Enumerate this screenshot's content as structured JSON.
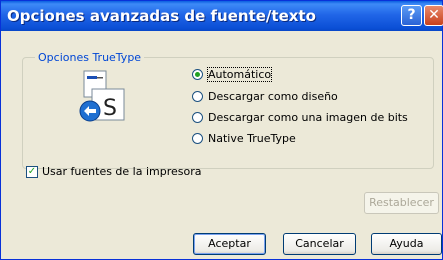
{
  "window": {
    "title": "Opciones avanzadas de fuente/texto",
    "help_glyph": "?",
    "close_glyph": "✕"
  },
  "truetype_group": {
    "legend": "Opciones TrueType",
    "icon": "font-substitution-icon",
    "options": [
      {
        "label": "Automático",
        "selected": true
      },
      {
        "label": "Descargar como diseño",
        "selected": false
      },
      {
        "label": "Descargar como una imagen de bits",
        "selected": false
      },
      {
        "label": "Native TrueType",
        "selected": false
      }
    ]
  },
  "printer_fonts_checkbox": {
    "label": "Usar fuentes de la impresora",
    "checked": true
  },
  "buttons": {
    "reset": "Restablecer",
    "accept": "Aceptar",
    "cancel": "Cancelar",
    "help": "Ayuda"
  },
  "colors": {
    "titlebar": "#0b4fd6",
    "legend_text": "#0046d5",
    "dialog_bg": "#ece9d8",
    "check_mark": "#21a121"
  }
}
